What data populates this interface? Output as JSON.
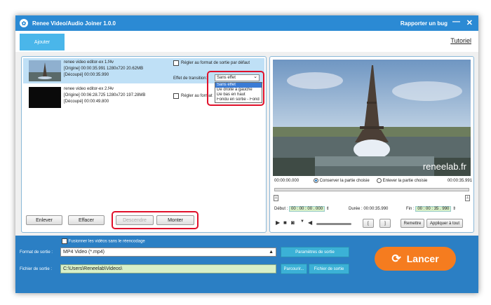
{
  "app": {
    "title": "Renee Video/Audio Joiner 1.0.0",
    "report_bug": "Rapporter un bug",
    "minimize": "—",
    "close": "✕"
  },
  "toolbar": {
    "add_label": "Ajouter",
    "tutorial_label": "Tutoriel"
  },
  "files": [
    {
      "name": "renee video editor-ex 1.f4v",
      "origin_line": "[Origine]    00:00:35.991  1280x720  20.62MB",
      "cut_line": "[Découpé]  00:00:35.990",
      "default_format_label": "Régler au format de sortie par défaut",
      "selected": true
    },
    {
      "name": "renee video editor-ex 2.f4v",
      "origin_line": "[Origine]    00:06:28.725  1280x720  197.28MB",
      "cut_line": "[Découpé]  00:00:49.800",
      "default_format_label": "Régler au format",
      "selected": false
    }
  ],
  "transition": {
    "label": "Effet de transition:",
    "selected": "Sans effet",
    "options": [
      "Sans effet",
      "De droite à gauche",
      "De bas en haut",
      "Fondu en sortie - Fond"
    ]
  },
  "list_buttons": {
    "remove": "Enlever",
    "clear": "Effacer",
    "down": "Descendre",
    "up": "Monter"
  },
  "preview": {
    "watermark": "reneelab.fr",
    "start_time": "00:00:00.000",
    "end_time": "00:00:35.991",
    "keep_label": "Conserver la partie choisie",
    "remove_label": "Enlever la partie choisie",
    "debut_label": "Début :",
    "debut_value": "00 : 00 : 00 . 000",
    "duree_label": "Durée : 00:00:35.990",
    "fin_label": "Fin :",
    "fin_value": "00 : 00 : 35 . 990",
    "bracket_open": "[",
    "bracket_close": "]",
    "reset_label": "Remettre",
    "apply_all_label": "Appliquer à tout"
  },
  "output": {
    "merge_label": "Fusionner les vidéos sans le réencodage",
    "format_label": "Format de sortie :",
    "format_value": "MP4 Video (*.mp4)",
    "params_label": "Paramètres de sortie",
    "folder_label": "Fichier de sortie :",
    "folder_value": "C:\\Users\\Reneelab\\Videos\\",
    "browse_label": "Parcourir...",
    "open_folder_label": "Fichier de sortie",
    "start_label": "Lancer"
  },
  "colors": {
    "accent_blue": "#2b7fc4",
    "lancer_orange": "#f57c1f",
    "highlight_red": "#e0102a"
  }
}
